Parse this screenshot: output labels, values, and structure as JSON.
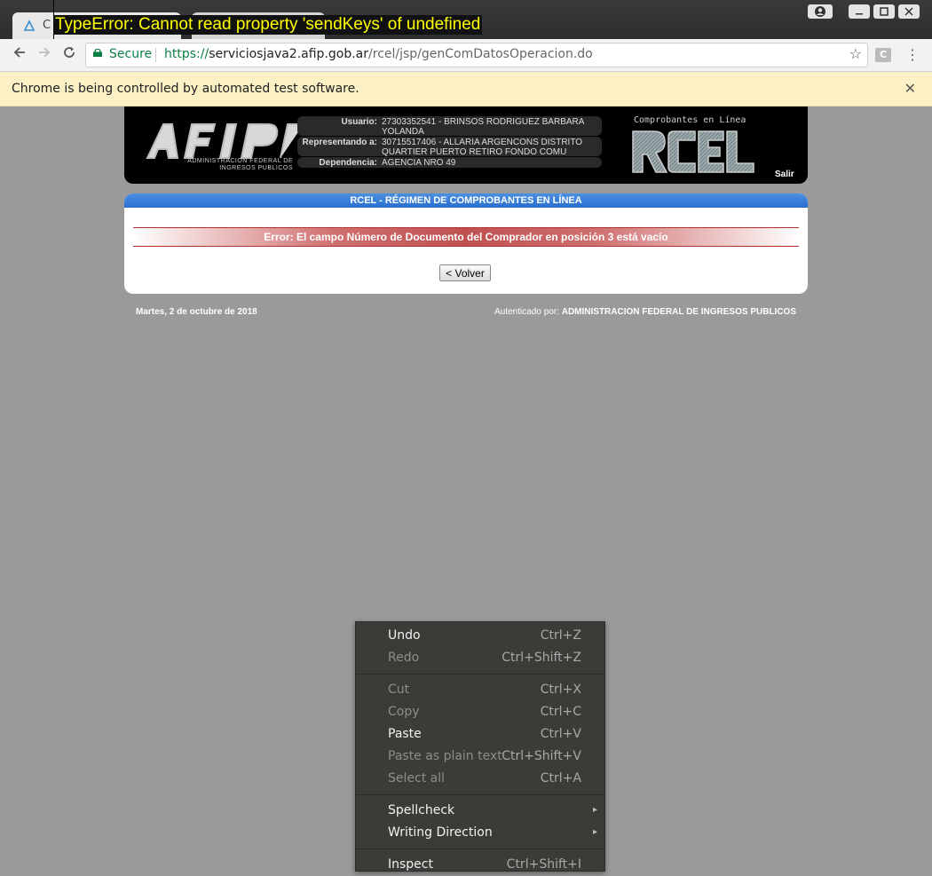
{
  "browser": {
    "tab1_title": "C",
    "error_overlay": "TypeError: Cannot read property 'sendKeys' of undefined",
    "secure_label": "Secure",
    "url_scheme": "https://",
    "url_host": "serviciosjava2.afip.gob.ar",
    "url_path": "/rcel/jsp/genComDatosOperacion.do",
    "extension_label": "C",
    "infobar_text": "Chrome is being controlled by automated test software.",
    "accent_color": "#0b8043"
  },
  "header": {
    "logo_sub": "ADMINISTRACION FEDERAL DE INGRESOS PUBLICOS",
    "usuario_label": "Usuario:",
    "usuario_value": "27303352541 - BRINSOS RODRIGUEZ BARBARA YOLANDA",
    "representando_label": "Representando a:",
    "representando_value": "30715517406 - ALLARIA ARGENCONS DISTRITO QUARTIER PUERTO RETIRO FONDO COMU",
    "dependencia_label": "Dependencia:",
    "dependencia_value": "AGENCIA NRO 49",
    "rcel_title": "Comprobantes en Línea",
    "salir": "Salir"
  },
  "panel": {
    "title": "RCEL - RÉGIMEN DE COMPROBANTES EN LÍNEA",
    "error_message": "Error: El campo Número de Documento del Comprador en posición 3 está vacío",
    "volver_label": "< Volver"
  },
  "footer": {
    "date": "Martes, 2 de octubre de 2018",
    "auth_prefix": "Autenticado por: ",
    "auth_entity": "ADMINISTRACION FEDERAL DE INGRESOS PUBLICOS"
  },
  "context_menu": {
    "undo": {
      "label": "Undo",
      "shortcut": "Ctrl+Z"
    },
    "redo": {
      "label": "Redo",
      "shortcut": "Ctrl+Shift+Z"
    },
    "cut": {
      "label": "Cut",
      "shortcut": "Ctrl+X"
    },
    "copy": {
      "label": "Copy",
      "shortcut": "Ctrl+C"
    },
    "paste": {
      "label": "Paste",
      "shortcut": "Ctrl+V"
    },
    "paste_plain": {
      "label": "Paste as plain text",
      "shortcut": "Ctrl+Shift+V"
    },
    "select_all": {
      "label": "Select all",
      "shortcut": "Ctrl+A"
    },
    "spellcheck": {
      "label": "Spellcheck"
    },
    "writing_direction": {
      "label": "Writing Direction"
    },
    "inspect": {
      "label": "Inspect",
      "shortcut": "Ctrl+Shift+I"
    }
  }
}
